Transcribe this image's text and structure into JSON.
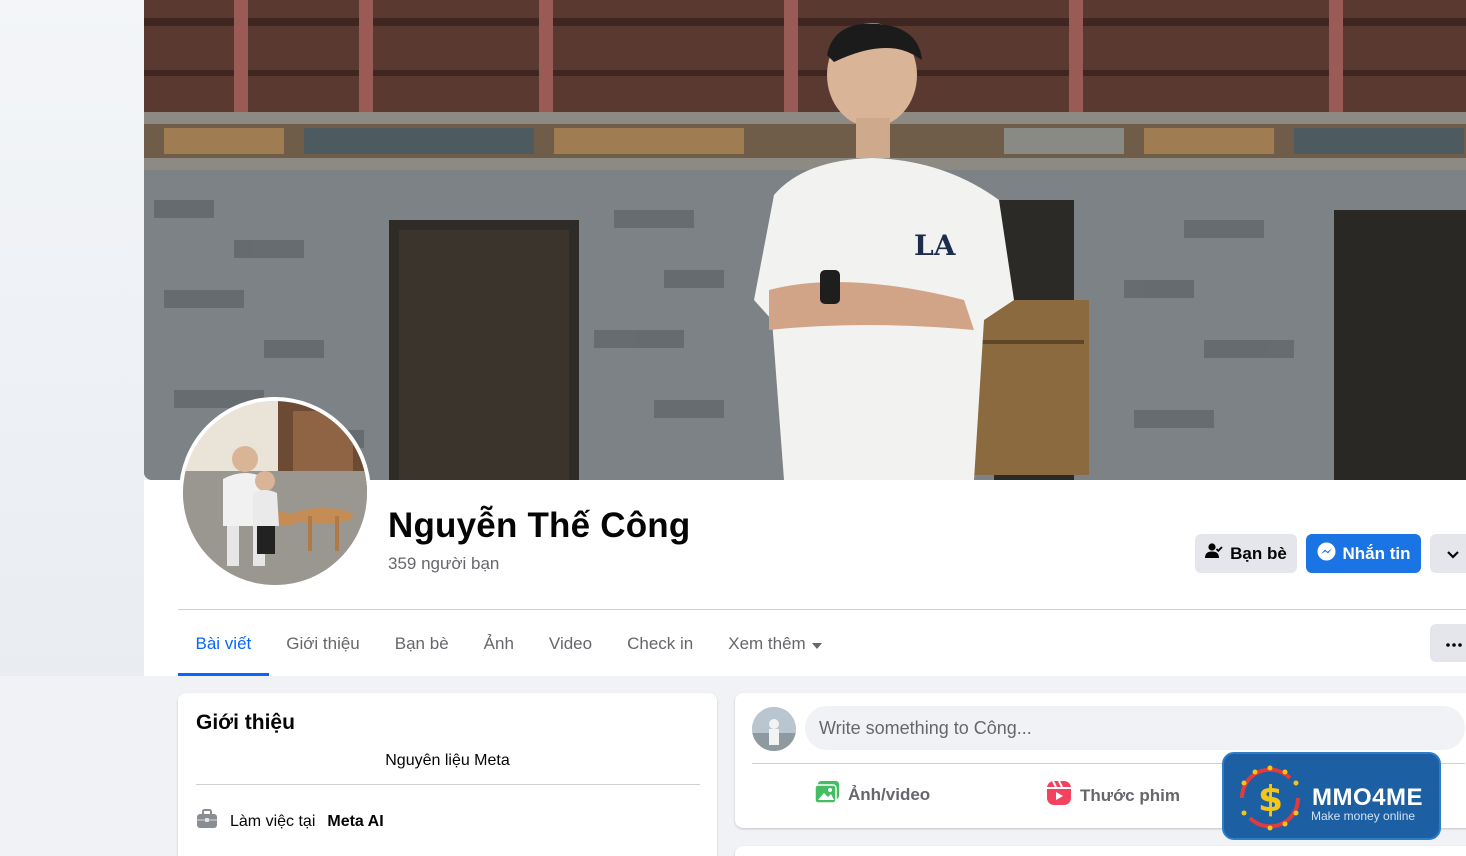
{
  "profile": {
    "name": "Nguyễn Thế Công",
    "friends_count": "359 người bạn"
  },
  "actions": {
    "friends_label": "Bạn bè",
    "message_label": "Nhắn tin",
    "more_icon": "chevron-down-icon"
  },
  "tabs": [
    {
      "label": "Bài viết",
      "active": true
    },
    {
      "label": "Giới thiệu",
      "active": false
    },
    {
      "label": "Bạn bè",
      "active": false
    },
    {
      "label": "Ảnh",
      "active": false
    },
    {
      "label": "Video",
      "active": false
    },
    {
      "label": "Check in",
      "active": false
    },
    {
      "label": "Xem thêm",
      "active": false
    }
  ],
  "tabs_more_icon": "ellipsis-icon",
  "intro": {
    "title": "Giới thiệu",
    "bio": "Nguyên liệu Meta",
    "work_prefix": "Làm việc tại",
    "work_place": "Meta AI"
  },
  "composer": {
    "placeholder": "Write something to Công...",
    "photo_label": "Ảnh/video",
    "reel_label": "Thước phim"
  },
  "watermark": {
    "title": "MMO4ME",
    "subtitle": "Make money online"
  },
  "colors": {
    "primary": "#0866ff",
    "message_button": "#1b74e4",
    "secondary_button": "#e4e6eb",
    "muted_text": "#65676b",
    "page_bg": "#f0f2f5"
  }
}
